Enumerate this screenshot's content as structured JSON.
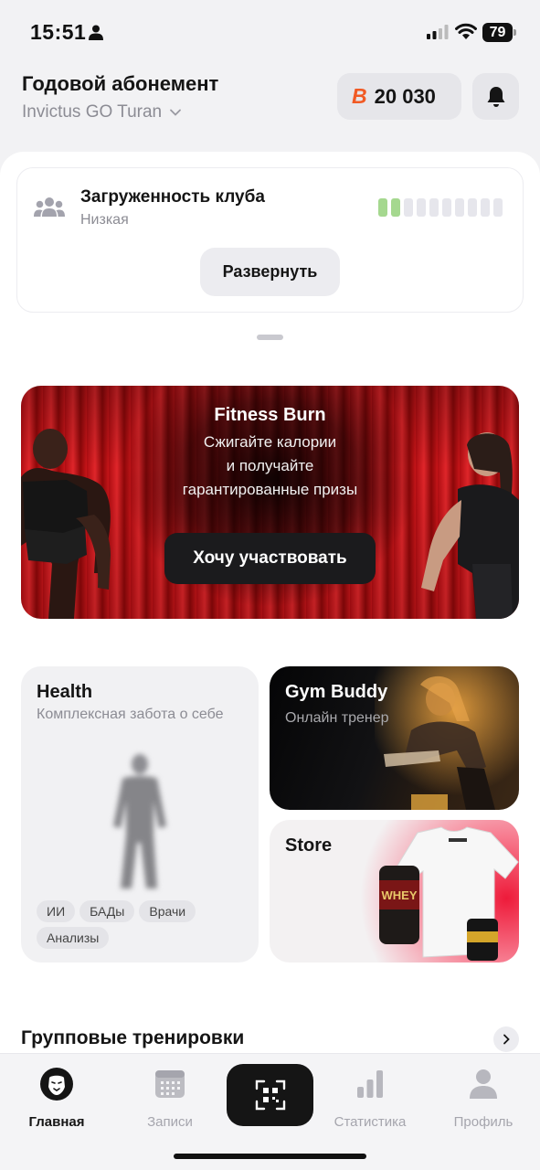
{
  "status_bar": {
    "time": "15:51",
    "battery": "79"
  },
  "header": {
    "membership_title": "Годовой абонемент",
    "club_name": "Invictus GO Turan",
    "points_logo": "B",
    "points": "20 030"
  },
  "club_load": {
    "title": "Загруженность клуба",
    "level": "Низкая",
    "bars_total": 10,
    "bars_active": 2,
    "expand_label": "Развернуть"
  },
  "promo": {
    "title": "Fitness Burn",
    "lines": [
      "Сжигайте калории",
      "и получайте",
      "гарантированные призы"
    ],
    "button_label": "Хочу участвовать"
  },
  "tiles": {
    "health": {
      "title": "Health",
      "subtitle": "Комплексная забота о себе",
      "tags": [
        "ИИ",
        "БАДы",
        "Врачи",
        "Анализы"
      ]
    },
    "gym_buddy": {
      "title": "Gym Buddy",
      "subtitle": "Онлайн тренер"
    },
    "store": {
      "title": "Store",
      "product_label": "WHEY"
    }
  },
  "group_trainings": {
    "title": "Групповые тренировки"
  },
  "tab_bar": {
    "tabs": [
      {
        "label": "Главная",
        "icon": "lion-logo-icon",
        "active": true
      },
      {
        "label": "Записи",
        "icon": "calendar-icon",
        "active": false
      },
      {
        "label": "Статистика",
        "icon": "bar-chart-icon",
        "active": false
      },
      {
        "label": "Профиль",
        "icon": "person-icon",
        "active": false
      }
    ],
    "scan_icon": "qr-scan-icon"
  },
  "colors": {
    "accent_orange": "#f15a24",
    "load_active": "#a5d88f",
    "banner_red": "#d71f24"
  }
}
